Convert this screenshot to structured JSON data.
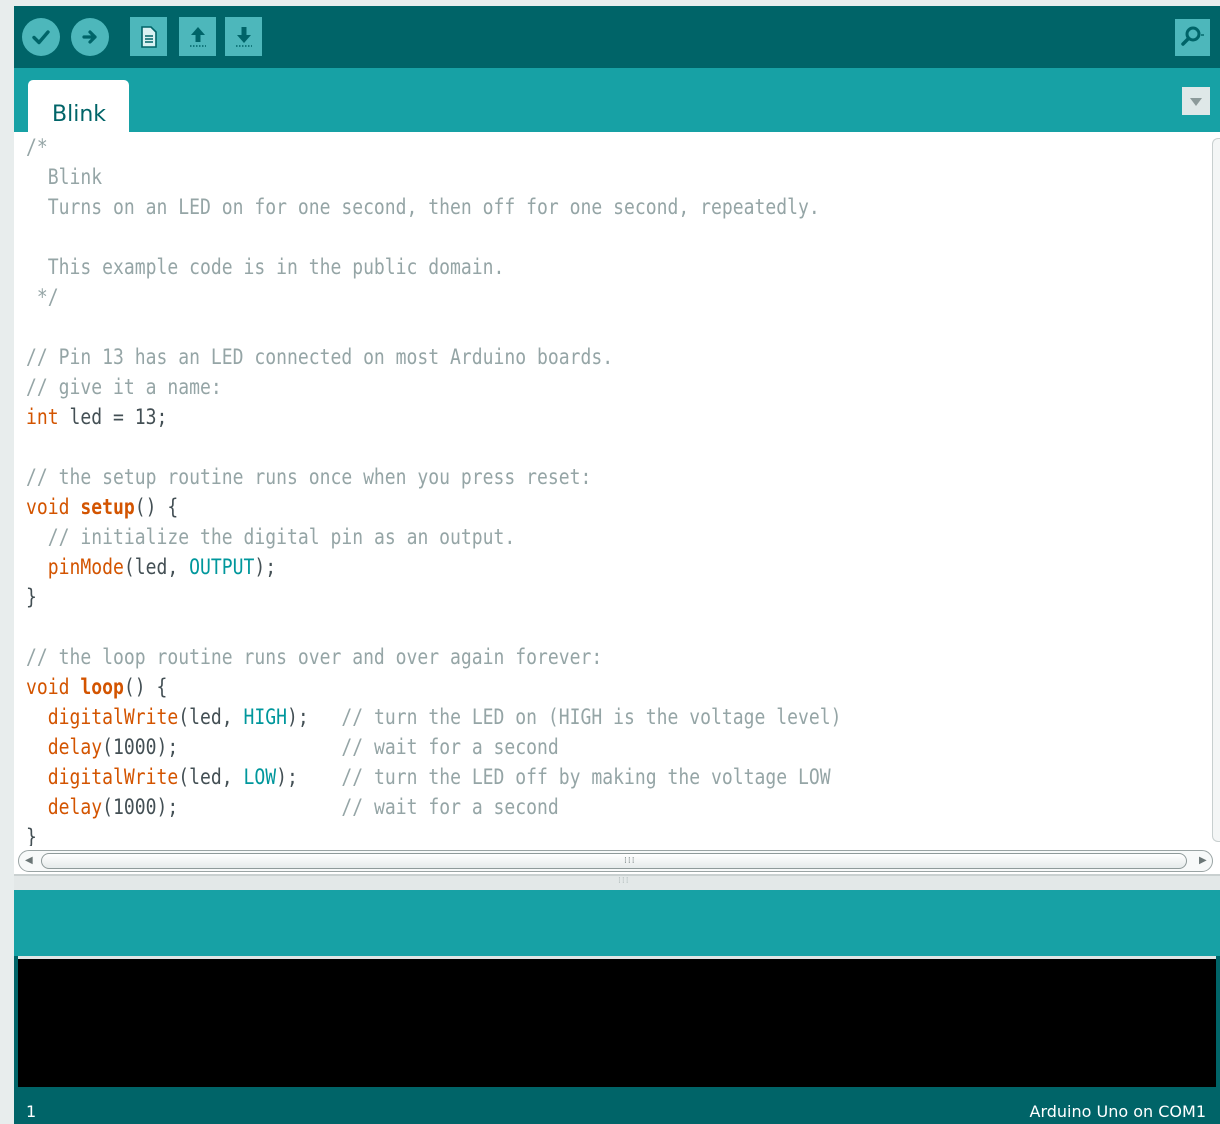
{
  "window": {
    "title": "Blink"
  },
  "toolbar": {
    "buttons": [
      {
        "name": "verify",
        "icon": "checkmark-icon"
      },
      {
        "name": "upload",
        "icon": "right-arrow-icon"
      },
      {
        "name": "new",
        "icon": "new-file-icon"
      },
      {
        "name": "open",
        "icon": "open-up-arrow-icon"
      },
      {
        "name": "save",
        "icon": "save-down-arrow-icon"
      },
      {
        "name": "serial-monitor",
        "icon": "magnifier-icon"
      }
    ]
  },
  "tabs": [
    {
      "label": "Blink",
      "active": true
    }
  ],
  "editor": {
    "lines": [
      [
        [
          "cm",
          "/*"
        ]
      ],
      [
        [
          "cm",
          "  Blink"
        ]
      ],
      [
        [
          "cm",
          "  Turns on an LED on for one second, then off for one second, repeatedly."
        ]
      ],
      [],
      [
        [
          "cm",
          "  This example code is in the public domain."
        ]
      ],
      [
        [
          "cm",
          " */"
        ]
      ],
      [],
      [
        [
          "cm",
          "// Pin 13 has an LED connected on most Arduino boards."
        ]
      ],
      [
        [
          "cm",
          "// give it a name:"
        ]
      ],
      [
        [
          "kw",
          "int"
        ],
        [
          "pl",
          " led = 13;"
        ]
      ],
      [],
      [
        [
          "cm",
          "// the setup routine runs once when you press reset:"
        ]
      ],
      [
        [
          "kw",
          "void"
        ],
        [
          "pl",
          " "
        ],
        [
          "fn",
          "setup"
        ],
        [
          "pl",
          "() {"
        ]
      ],
      [
        [
          "pl",
          "  "
        ],
        [
          "cm",
          "// initialize the digital pin as an output."
        ]
      ],
      [
        [
          "pl",
          "  "
        ],
        [
          "bi",
          "pinMode"
        ],
        [
          "pl",
          "(led, "
        ],
        [
          "ct",
          "OUTPUT"
        ],
        [
          "pl",
          ");"
        ]
      ],
      [
        [
          "pl",
          "}"
        ]
      ],
      [],
      [
        [
          "cm",
          "// the loop routine runs over and over again forever:"
        ]
      ],
      [
        [
          "kw",
          "void"
        ],
        [
          "pl",
          " "
        ],
        [
          "fn",
          "loop"
        ],
        [
          "pl",
          "() {"
        ]
      ],
      [
        [
          "pl",
          "  "
        ],
        [
          "bi",
          "digitalWrite"
        ],
        [
          "pl",
          "(led, "
        ],
        [
          "ct",
          "HIGH"
        ],
        [
          "pl",
          ");   "
        ],
        [
          "cm",
          "// turn the LED on (HIGH is the voltage level)"
        ]
      ],
      [
        [
          "pl",
          "  "
        ],
        [
          "bi",
          "delay"
        ],
        [
          "pl",
          "(1000);               "
        ],
        [
          "cm",
          "// wait for a second"
        ]
      ],
      [
        [
          "pl",
          "  "
        ],
        [
          "bi",
          "digitalWrite"
        ],
        [
          "pl",
          "(led, "
        ],
        [
          "ct",
          "LOW"
        ],
        [
          "pl",
          ");    "
        ],
        [
          "cm",
          "// turn the LED off by making the voltage LOW"
        ]
      ],
      [
        [
          "pl",
          "  "
        ],
        [
          "bi",
          "delay"
        ],
        [
          "pl",
          "(1000);               "
        ],
        [
          "cm",
          "// wait for a second"
        ]
      ],
      [
        [
          "pl",
          "}"
        ]
      ]
    ]
  },
  "status": {
    "line_number": "1",
    "board": "Arduino Uno on COM1"
  },
  "colors": {
    "toolbar": "#006468",
    "tab_strip": "#17a1a5",
    "button": "#4db7bb",
    "keyword": "#d35400",
    "constant": "#00979c",
    "comment": "#95a5a6",
    "text": "#434f54"
  }
}
